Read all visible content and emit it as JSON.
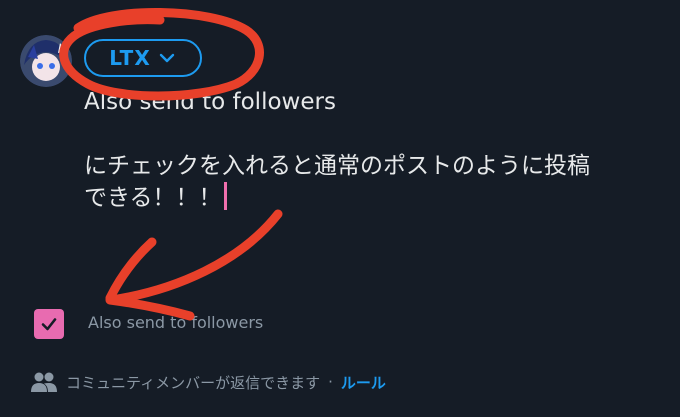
{
  "composer": {
    "audience_label": "LTX",
    "text_line1": "Also send to followers",
    "text_line2": "",
    "text_line3": "にチェックを入れると通常のポストのように投稿",
    "text_line4": "できる！！！"
  },
  "options": {
    "also_send_label": "Also send to followers",
    "also_send_checked": true
  },
  "footer": {
    "reply_text": "コミュニティメンバーが返信できます",
    "separator": "·",
    "rules_link": "ルール"
  },
  "colors": {
    "background": "#151c26",
    "accent": "#1d9bf0",
    "checkbox": "#e86bb0",
    "annotation": "#e8402a"
  },
  "icons": {
    "audience_chevron": "chevron-down-icon",
    "checkbox": "checkmark-icon",
    "footer": "people-icon"
  }
}
